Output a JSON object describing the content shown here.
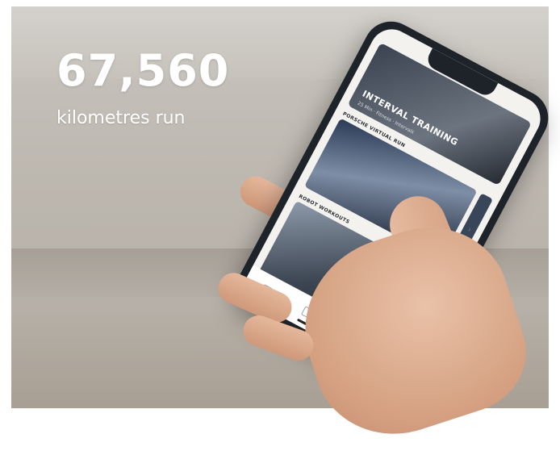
{
  "stat": {
    "value": "67,560",
    "label": "kilometres run"
  },
  "phone": {
    "hero_title": "INTERVAL TRAINING",
    "hero_meta": "25 Min · Fitness · Intervals",
    "sections": [
      {
        "title": "PORSCHE VIRTUAL RUN"
      },
      {
        "title": "ROBOT WORKOUTS"
      }
    ]
  },
  "colors": {
    "stat_text": "#ffffff",
    "phone_body": "#1e2329",
    "background_blur": "#c6c2bb"
  }
}
